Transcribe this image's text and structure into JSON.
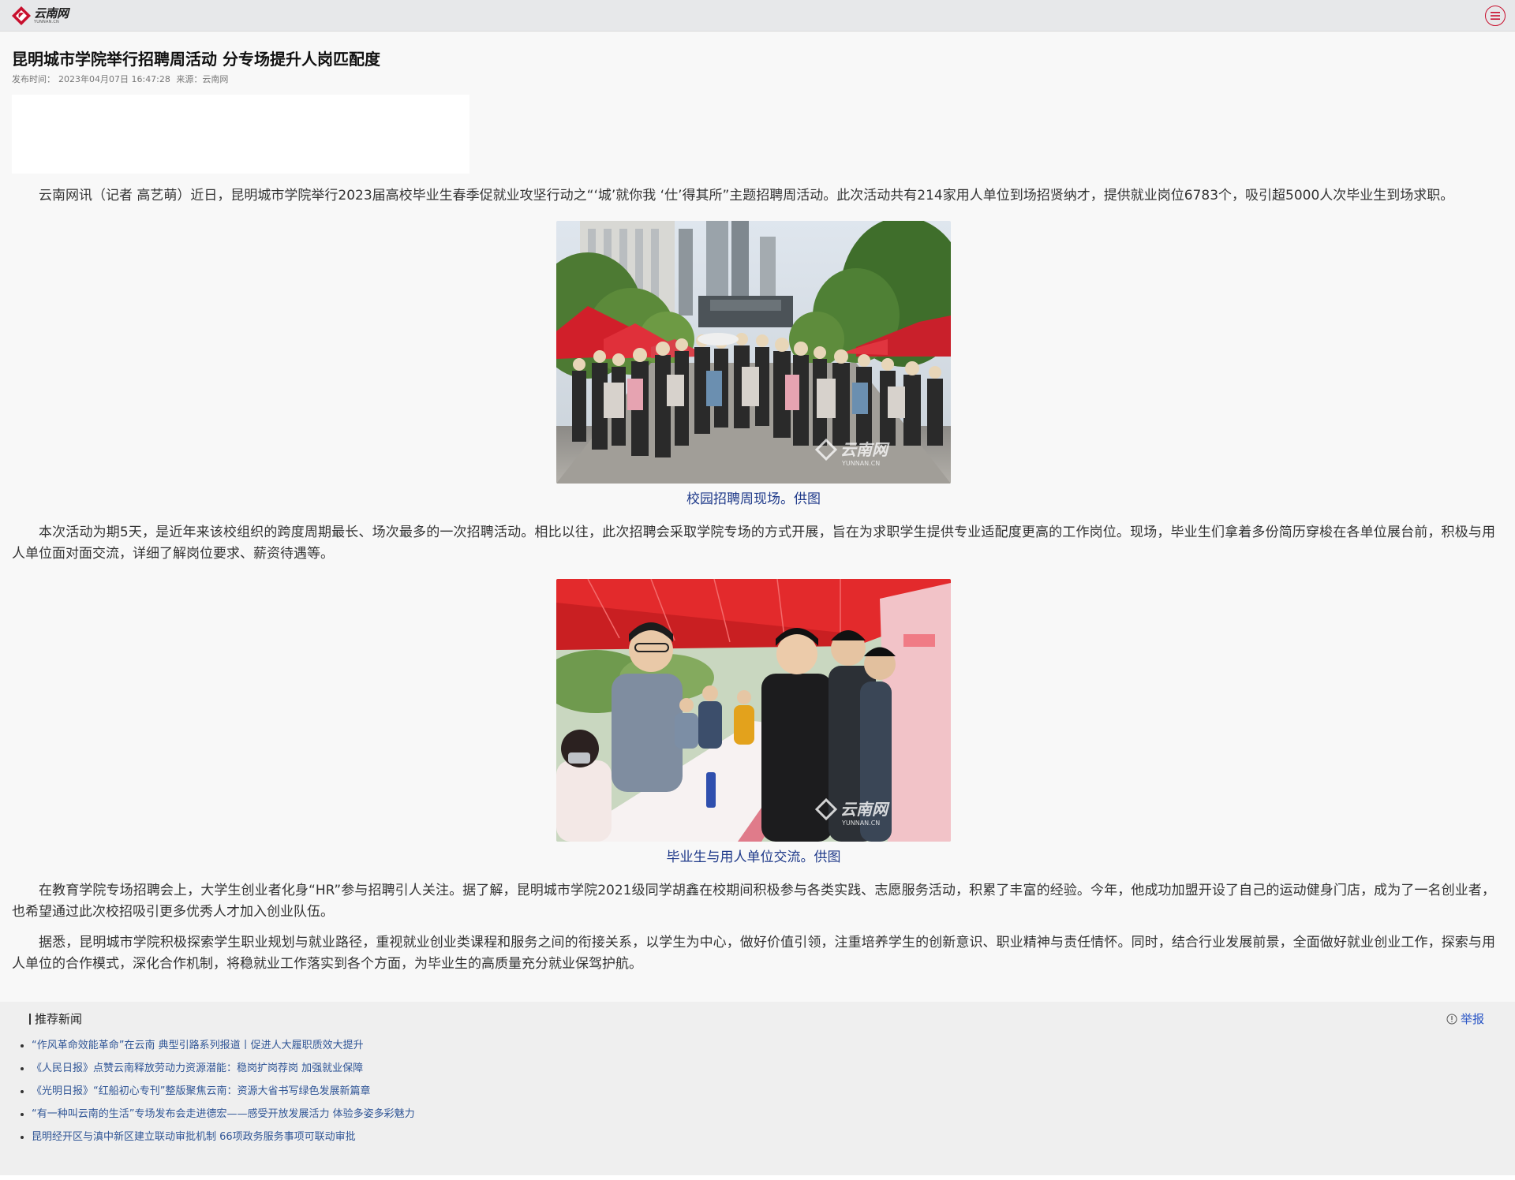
{
  "header": {
    "logo_cn": "云南网",
    "logo_en": "YUNNAN.CN",
    "brand_color": "#c8102e"
  },
  "article": {
    "title": "昆明城市学院举行招聘周活动 分专场提升人岗匹配度",
    "publish_label": "发布时间：",
    "publish_time": "2023年04月07日 16:47:28",
    "source_label": "来源：",
    "source": "云南网",
    "paragraphs": [
      "云南网讯（记者 高艺萌）近日，昆明城市学院举行2023届高校毕业生春季促就业攻坚行动之“‘城’就你我 ‘仕’得其所”主题招聘周活动。此次活动共有214家用人单位到场招贤纳才，提供就业岗位6783个，吸引超5000人次毕业生到场求职。",
      "本次活动为期5天，是近年来该校组织的跨度周期最长、场次最多的一次招聘活动。相比以往，此次招聘会采取学院专场的方式开展，旨在为求职学生提供专业适配度更高的工作岗位。现场，毕业生们拿着多份简历穿梭在各单位展台前，积极与用人单位面对面交流，详细了解岗位要求、薪资待遇等。",
      "在教育学院专场招聘会上，大学生创业者化身“HR”参与招聘引人关注。据了解，昆明城市学院2021级同学胡鑫在校期间积极参与各类实践、志愿服务活动，积累了丰富的经验。今年，他成功加盟开设了自己的运动健身门店，成为了一名创业者，也希望通过此次校招吸引更多优秀人才加入创业队伍。",
      "据悉，昆明城市学院积极探索学生职业规划与就业路径，重视就业创业类课程和服务之间的衔接关系，以学生为中心，做好价值引领，注重培养学生的创新意识、职业精神与责任情怀。同时，结合行业发展前景，全面做好就业创业工作，探索与用人单位的合作模式，深化合作机制，将稳就业工作落实到各个方面，为毕业生的高质量充分就业保驾护航。"
    ],
    "figures": [
      {
        "caption": "校园招聘周现场。供图",
        "watermark": "云南网",
        "watermark_en": "YUNNAN.CN"
      },
      {
        "caption": "毕业生与用人单位交流。供图",
        "watermark": "云南网",
        "watermark_en": "YUNNAN.CN"
      }
    ]
  },
  "recommend": {
    "heading": "推荐新闻",
    "report_label": "举报",
    "items": [
      "“作风革命效能革命”在云南 典型引路系列报道丨促进人大履职质效大提升",
      "《人民日报》点赞云南释放劳动力资源潜能：稳岗扩岗荐岗 加强就业保障",
      "《光明日报》“红船初心专刊”整版聚焦云南：资源大省书写绿色发展新篇章",
      "“有一种叫云南的生活”专场发布会走进德宏——感受开放发展活力 体验多姿多彩魅力",
      "昆明经开区与滇中新区建立联动审批机制 66项政务服务事项可联动审批"
    ]
  }
}
